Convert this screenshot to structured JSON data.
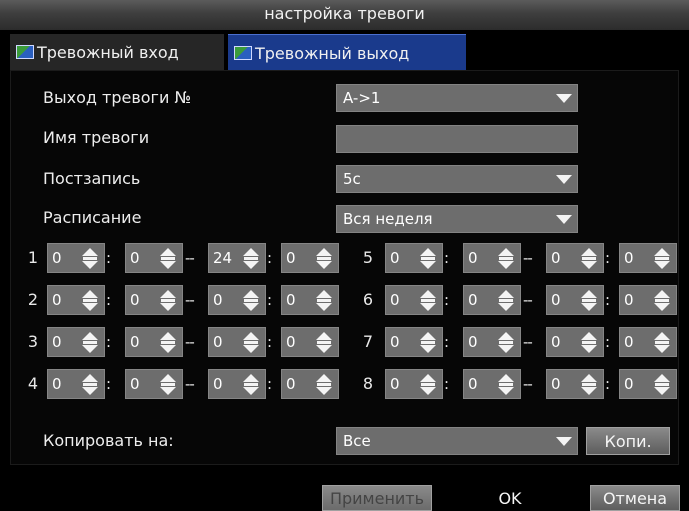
{
  "window": {
    "title": "настройка тревоги"
  },
  "tabs": [
    {
      "label": "Тревожный вход",
      "icon": "tab-image-icon",
      "active": false
    },
    {
      "label": "Тревожный выход",
      "icon": "tab-image-icon",
      "active": true
    }
  ],
  "form": {
    "alarm_output": {
      "label": "Выход тревоги №",
      "value": "A->1"
    },
    "alarm_name": {
      "label": "Имя тревоги",
      "value": ""
    },
    "post_record": {
      "label": "Постзапись",
      "value": "5с"
    },
    "schedule": {
      "label": "Расписание",
      "value": "Вся неделя"
    }
  },
  "periods": {
    "left": [
      {
        "num": "1",
        "start_h": "0",
        "start_m": "0",
        "end_h": "24",
        "end_m": "0"
      },
      {
        "num": "2",
        "start_h": "0",
        "start_m": "0",
        "end_h": "0",
        "end_m": "0"
      },
      {
        "num": "3",
        "start_h": "0",
        "start_m": "0",
        "end_h": "0",
        "end_m": "0"
      },
      {
        "num": "4",
        "start_h": "0",
        "start_m": "0",
        "end_h": "0",
        "end_m": "0"
      }
    ],
    "right": [
      {
        "num": "5",
        "start_h": "0",
        "start_m": "0",
        "end_h": "0",
        "end_m": "0"
      },
      {
        "num": "6",
        "start_h": "0",
        "start_m": "0",
        "end_h": "0",
        "end_m": "0"
      },
      {
        "num": "7",
        "start_h": "0",
        "start_m": "0",
        "end_h": "0",
        "end_m": "0"
      },
      {
        "num": "8",
        "start_h": "0",
        "start_m": "0",
        "end_h": "0",
        "end_m": "0"
      }
    ],
    "time_separator": ":",
    "range_separator": "--"
  },
  "copy": {
    "label": "Копировать на:",
    "value": "Все",
    "button": "Копи."
  },
  "footer": {
    "apply": "Применить",
    "ok": "OK",
    "cancel": "Отмена"
  },
  "colors": {
    "active_tab": "#1a3a8c",
    "field_bg": "#6d6d6d",
    "background": "#000000"
  }
}
